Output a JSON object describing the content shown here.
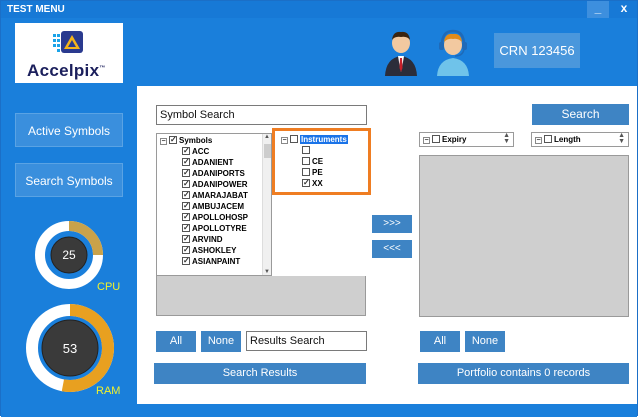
{
  "window": {
    "title": "TEST MENU",
    "minimize": "_",
    "close": "x"
  },
  "header": {
    "logo_text_main": "Accel",
    "logo_text_accent": "pix",
    "logo_tm": "™",
    "crn_label": "CRN 123456"
  },
  "sidebar": {
    "active_symbols": "Active Symbols",
    "search_symbols": "Search Symbols",
    "cpu": {
      "value": "25",
      "label": "CPU",
      "fraction": 0.25
    },
    "ram": {
      "value": "53",
      "label": "RAM",
      "fraction": 0.53
    }
  },
  "left_panel": {
    "symbol_search_value": "Symbol Search",
    "symbols_root": "Symbols",
    "symbols": [
      "ACC",
      "ADANIENT",
      "ADANIPORTS",
      "ADANIPOWER",
      "AMARAJABAT",
      "AMBUJACEM",
      "APOLLOHOSP",
      "APOLLOTYRE",
      "ARVIND",
      "ASHOKLEY",
      "ASIANPAINT"
    ],
    "instruments_root": "Instruments",
    "instruments": [
      {
        "label": "",
        "checked": false
      },
      {
        "label": "CE",
        "checked": false
      },
      {
        "label": "PE",
        "checked": false
      },
      {
        "label": "XX",
        "checked": true
      }
    ],
    "all_button": "All",
    "none_button": "None",
    "results_search_value": "Results Search",
    "search_results_button": "Search Results"
  },
  "transfer": {
    "add": ">>>",
    "remove": "<<<"
  },
  "right_panel": {
    "search_button": "Search",
    "expiry_label": "Expiry",
    "length_label": "Length",
    "all_button": "All",
    "none_button": "None",
    "portfolio_status": "Portfolio contains 0 records"
  },
  "colors": {
    "brand_blue": "#1a7fdb",
    "button_blue": "#3e84c4",
    "highlight_orange": "#ef7d22",
    "gauge_label": "#f2f22a"
  }
}
